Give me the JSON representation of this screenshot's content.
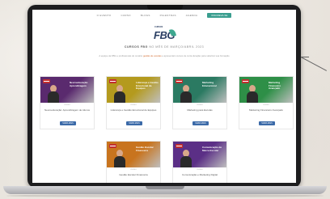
{
  "nav": {
    "links": [
      "O EVENTO",
      "CURSO",
      "BLOGS",
      "PALESTRAS",
      "AGENDA"
    ],
    "cta": "INSCREVA-SE"
  },
  "logo": {
    "small": "CURSOS",
    "main": "FBG"
  },
  "hero": {
    "headline_prefix": "CURSOS FBG",
    "headline_rest": " NO MÊS DE MARÇO/ABRIL 2023",
    "sub_before": "A equipe da FBG e profissionais do cenário ",
    "sub_highlight": "gestão de escolas",
    "sub_after": " e apresentam cursos de curta duração para valorizar sua formação"
  },
  "cards": [
    {
      "title": "Neuroeducação: Aprendizagem de Alunos",
      "tag": "CURSO",
      "thumb_title": "Neuroeducação Aprendizagem",
      "button": "SAIBA MAIS",
      "color": "#5a2a6e"
    },
    {
      "title": "Liderança e Gestão Emocional de Equipes",
      "tag": "CURSO",
      "thumb_title": "Liderança e Gestão Emocional de Equipes",
      "button": "SAIBA MAIS",
      "color": "#b49a1e"
    },
    {
      "title": "Marketing para Escolas",
      "tag": "CURSO",
      "thumb_title": "Marketing Educacional",
      "button": "SAIBA MAIS",
      "color": "#2b7a62"
    },
    {
      "title": "Marketing Financeiro Avançado",
      "tag": "CURSO",
      "thumb_title": "Marketing Financeiro Avançado",
      "button": "SAIBA MAIS",
      "color": "#2e8f47"
    },
    {
      "title": "Gestão Escolar Financeira",
      "tag": "CURSO",
      "thumb_title": "Gestão Escolar Financeira",
      "button": "SAIBA MAIS",
      "color": "#c8741e"
    },
    {
      "title": "Comunicação e Marketing Digital",
      "tag": "CURSO",
      "thumb_title": "Comunicação de Marca Escolar",
      "button": "SAIBA MAIS",
      "color": "#5b2f86"
    }
  ]
}
